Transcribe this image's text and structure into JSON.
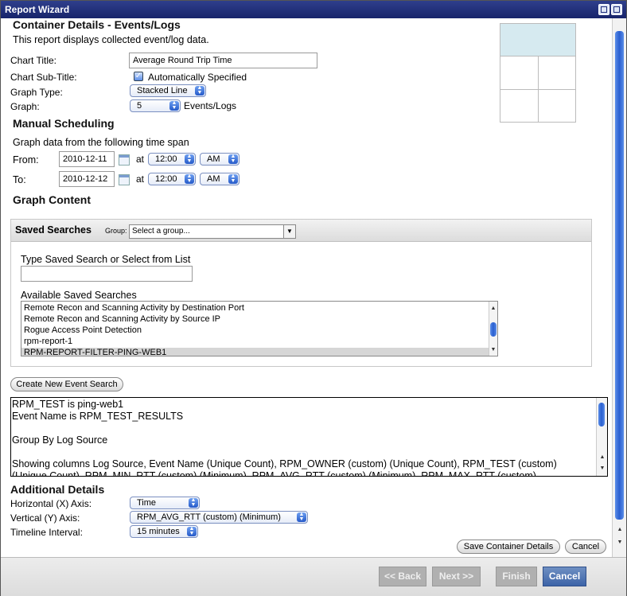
{
  "window": {
    "title": "Report Wizard"
  },
  "container": {
    "heading": "Container Details - Events/Logs",
    "description": "This report displays collected event/log data.",
    "chart_title_label": "Chart Title:",
    "chart_title_value": "Average Round Trip Time",
    "chart_subtitle_label": "Chart Sub-Title:",
    "auto_specified_label": "Automatically Specified",
    "graph_type_label": "Graph Type:",
    "graph_type_value": "Stacked Line",
    "graph_label": "Graph:",
    "graph_value": "5",
    "graph_unit": "Events/Logs"
  },
  "scheduling": {
    "heading": "Manual Scheduling",
    "description": "Graph data from the following time span",
    "from_label": "From:",
    "from_date": "2010-12-11",
    "from_at": "at",
    "from_time": "12:00",
    "from_ampm": "AM",
    "to_label": "To:",
    "to_date": "2010-12-12",
    "to_at": "at",
    "to_time": "12:00",
    "to_ampm": "AM"
  },
  "graph_content": {
    "heading": "Graph Content"
  },
  "saved_searches": {
    "title": "Saved Searches",
    "group_label": "Group:",
    "group_value": "Select a group...",
    "type_label": "Type Saved Search or Select from List",
    "type_value": "",
    "available_label": "Available Saved Searches",
    "items": [
      "Remote Recon and Scanning Activity by Destination Port",
      "Remote Recon and Scanning Activity by Source IP",
      "Rogue Access Point Detection",
      "rpm-report-1",
      "RPM-REPORT-FILTER-PING-WEB1"
    ],
    "selected_index": 4
  },
  "create_event_search_label": "Create New Event Search",
  "search_details": {
    "lines": [
      "RPM_TEST is ping-web1",
      "Event Name is RPM_TEST_RESULTS",
      "",
      "Group By Log Source",
      "",
      "Showing columns Log Source, Event Name (Unique Count), RPM_OWNER (custom) (Unique Count), RPM_TEST (custom)",
      "(Unique Count), RPM_MIN_RTT (custom) (Minimum), RPM_AVG_RTT (custom) (Minimum), RPM_MAX_RTT (custom)"
    ]
  },
  "additional": {
    "heading": "Additional Details",
    "x_axis_label": "Horizontal (X) Axis:",
    "x_axis_value": "Time",
    "y_axis_label": "Vertical (Y) Axis:",
    "y_axis_value": "RPM_AVG_RTT (custom) (Minimum)",
    "interval_label": "Timeline Interval:",
    "interval_value": "15 minutes"
  },
  "actions": {
    "save_container": "Save Container Details",
    "cancel": "Cancel"
  },
  "footer": {
    "back": "<< Back",
    "next": "Next >>",
    "finish": "Finish",
    "cancel": "Cancel"
  },
  "colors": {
    "titlebar": "#1f2f7d",
    "primary_button": "#4a6fb0",
    "preview_highlight": "#d6eaf0"
  }
}
